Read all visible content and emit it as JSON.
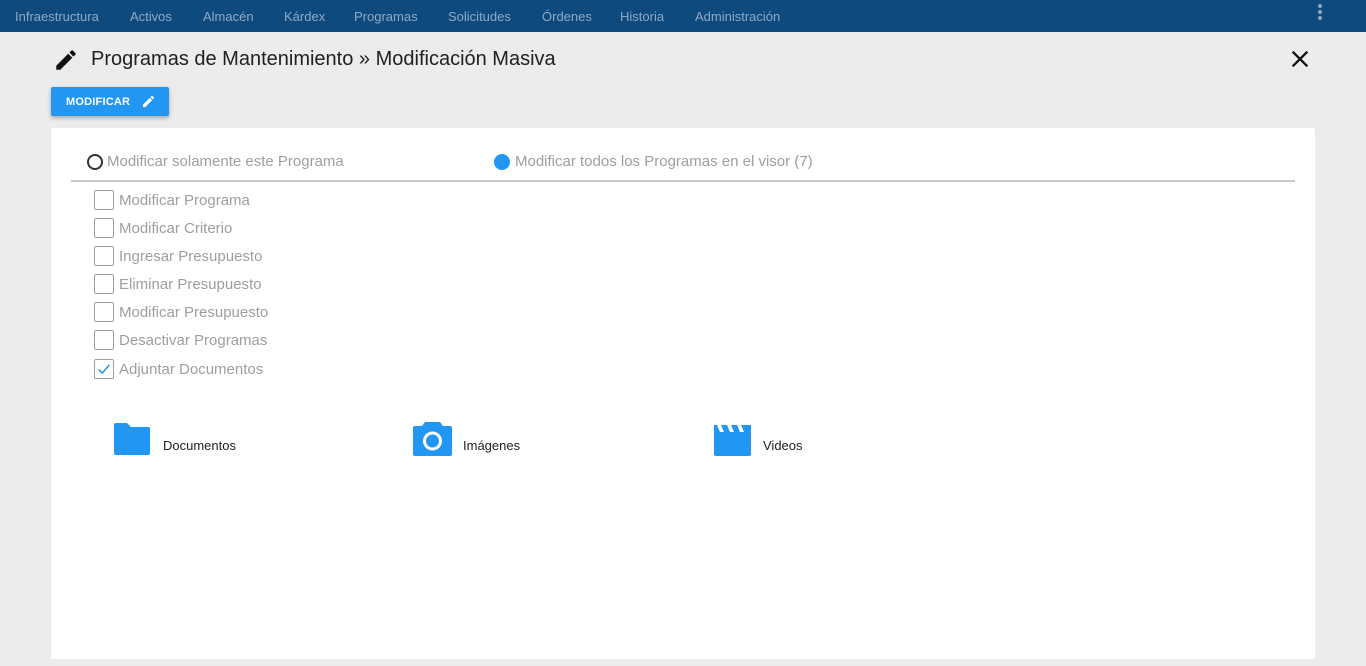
{
  "nav": {
    "items": [
      "Infraestructura",
      "Activos",
      "Almacén",
      "Kárdex",
      "Programas",
      "Solicitudes",
      "Órdenes",
      "Historia",
      "Administración"
    ],
    "more_icon": "more-vert-icon"
  },
  "header": {
    "icon": "pencil-icon",
    "title": "Programas de Mantenimiento » Modificación Masiva",
    "close_icon": "close-icon"
  },
  "toolbar": {
    "modify_label": "MODIFICAR",
    "modify_icon": "pencil-icon"
  },
  "scope": {
    "options": [
      {
        "label": "Modificar solamente este Programa",
        "selected": false
      },
      {
        "label": "Modificar todos los Programas en el visor (7)",
        "selected": true
      }
    ]
  },
  "actions": [
    {
      "label": "Modificar Programa",
      "checked": false
    },
    {
      "label": "Modificar Criterio",
      "checked": false
    },
    {
      "label": "Ingresar Presupuesto",
      "checked": false
    },
    {
      "label": "Eliminar Presupuesto",
      "checked": false
    },
    {
      "label": "Modificar Presupuesto",
      "checked": false
    },
    {
      "label": "Desactivar Programas",
      "checked": false
    },
    {
      "label": "Adjuntar Documentos",
      "checked": true
    }
  ],
  "attachments": [
    {
      "label": "Documentos",
      "icon": "folder-icon"
    },
    {
      "label": "Imágenes",
      "icon": "camera-icon"
    },
    {
      "label": "Videos",
      "icon": "video-clapper-icon"
    }
  ],
  "colors": {
    "nav_bg": "#0f4a7f",
    "accent": "#2196f3",
    "muted_text": "#9e9e9e"
  }
}
